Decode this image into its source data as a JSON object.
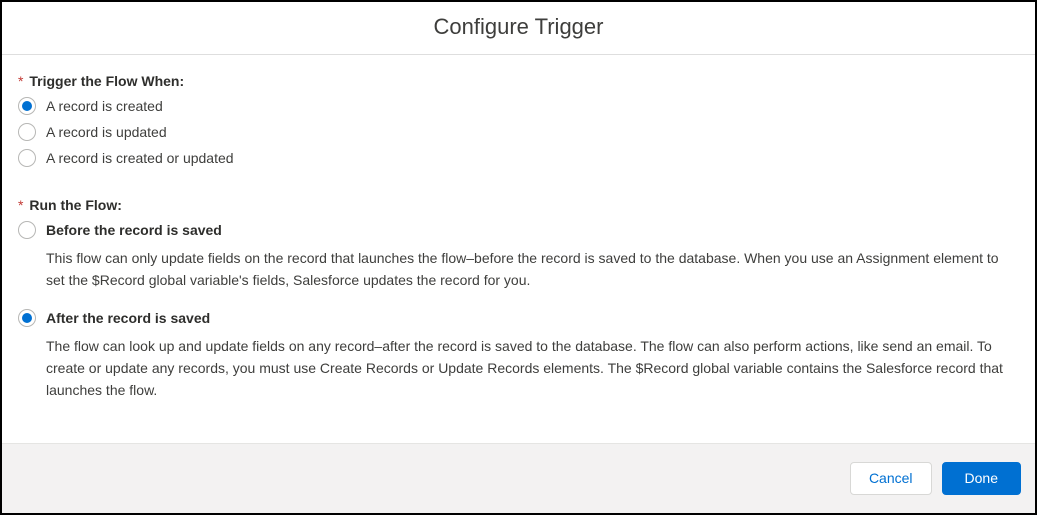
{
  "header": {
    "title": "Configure Trigger"
  },
  "section_trigger": {
    "required_mark": "*",
    "label": "Trigger the Flow When:",
    "options": [
      {
        "label": "A record is created",
        "selected": true
      },
      {
        "label": "A record is updated",
        "selected": false
      },
      {
        "label": "A record is created or updated",
        "selected": false
      }
    ]
  },
  "section_run": {
    "required_mark": "*",
    "label": "Run the Flow:",
    "options": [
      {
        "label": "Before the record is saved",
        "selected": false,
        "description": "This flow can only update fields on the record that launches the flow–before the record is saved to the database. When you use an Assignment element to set the $Record global variable's fields, Salesforce updates the record for you."
      },
      {
        "label": "After the record is saved",
        "selected": true,
        "description": "The flow can look up and update fields on any record–after the record is saved to the database. The flow can also perform actions, like send an email. To create or update any records, you must use Create Records or Update Records elements. The $Record global variable contains the Salesforce record that launches the flow."
      }
    ]
  },
  "footer": {
    "cancel_label": "Cancel",
    "done_label": "Done"
  }
}
